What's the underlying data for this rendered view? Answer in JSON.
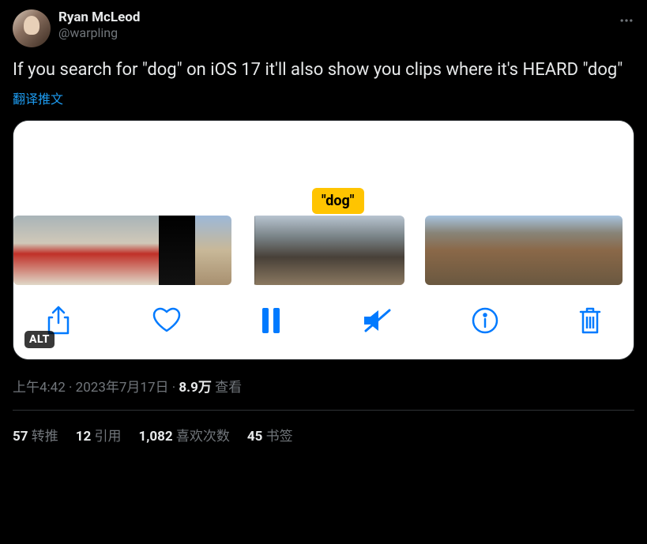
{
  "author": {
    "display_name": "Ryan McLeod",
    "handle": "@warpling"
  },
  "tweet_text": "If you search for \"dog\" on iOS 17 it'll also show you clips where it's HEARD \"dog\"",
  "translate_label": "翻译推文",
  "media": {
    "search_token": "\"dog\"",
    "alt_badge": "ALT"
  },
  "meta": {
    "time": "上午4:42",
    "date": "2023年7月17日",
    "views_count": "8.9万",
    "views_label": "查看",
    "separator": " · "
  },
  "stats": {
    "retweets_count": "57",
    "retweets_label": "转推",
    "quotes_count": "12",
    "quotes_label": "引用",
    "likes_count": "1,082",
    "likes_label": "喜欢次数",
    "bookmarks_count": "45",
    "bookmarks_label": "书签"
  }
}
